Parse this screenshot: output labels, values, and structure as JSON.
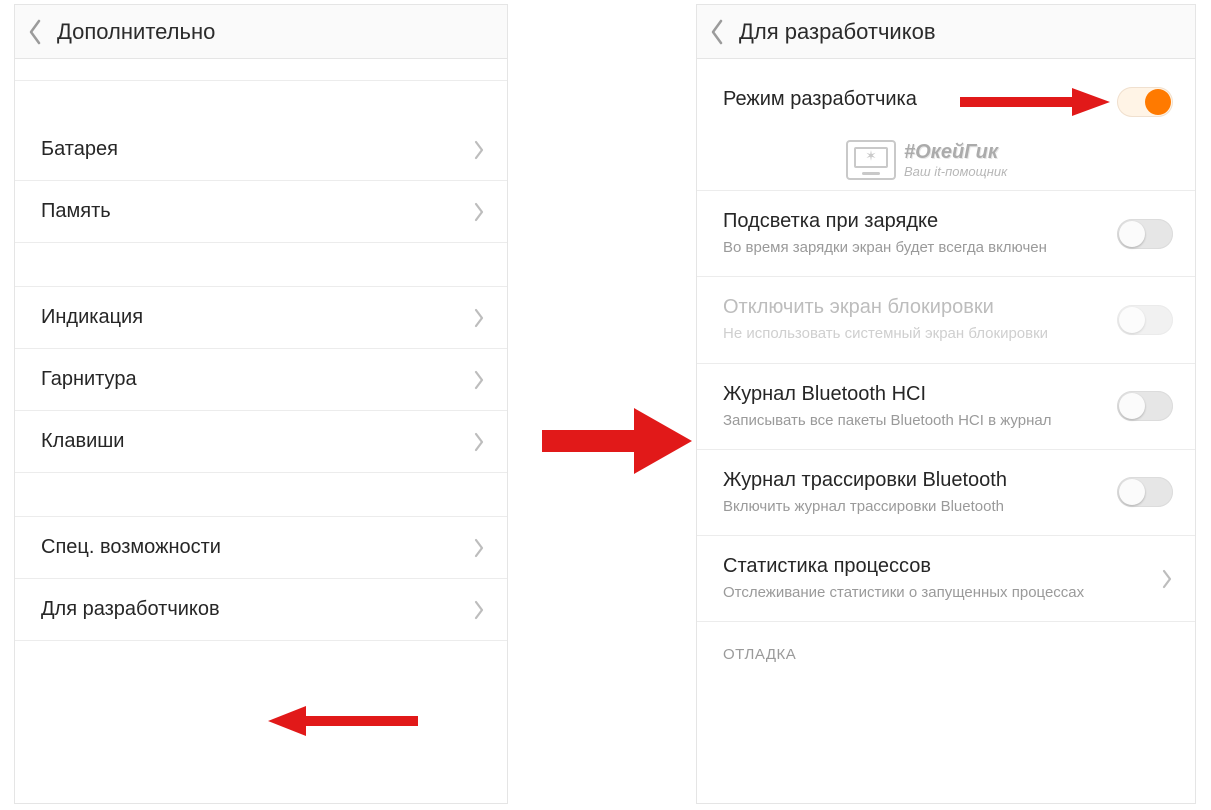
{
  "left": {
    "title": "Дополнительно",
    "items": {
      "battery": "Батарея",
      "memory": "Память",
      "indication": "Индикация",
      "headset": "Гарнитура",
      "keys": "Клавиши",
      "accessibility": "Спец. возможности",
      "developers": "Для разработчиков"
    }
  },
  "right": {
    "title": "Для разработчиков",
    "dev_mode": {
      "label": "Режим разработчика"
    },
    "backlight": {
      "label": "Подсветка при зарядке",
      "sub": "Во время зарядки экран будет всегда включен"
    },
    "lockscreen_off": {
      "label": "Отключить экран блокировки",
      "sub": "Не использовать системный экран блокировки"
    },
    "bt_hci": {
      "label": "Журнал Bluetooth HCI",
      "sub": "Записывать все пакеты Bluetooth HCI в журнал"
    },
    "bt_trace": {
      "label": "Журнал трассировки Bluetooth",
      "sub": "Включить журнал трассировки Bluetooth"
    },
    "proc_stats": {
      "label": "Статистика процессов",
      "sub": "Отслеживание статистики о запущенных процессах"
    },
    "debug_section": "ОТЛАДКА"
  },
  "watermark": {
    "line1": "#ОкейГик",
    "line2": "Ваш it-помощник"
  }
}
